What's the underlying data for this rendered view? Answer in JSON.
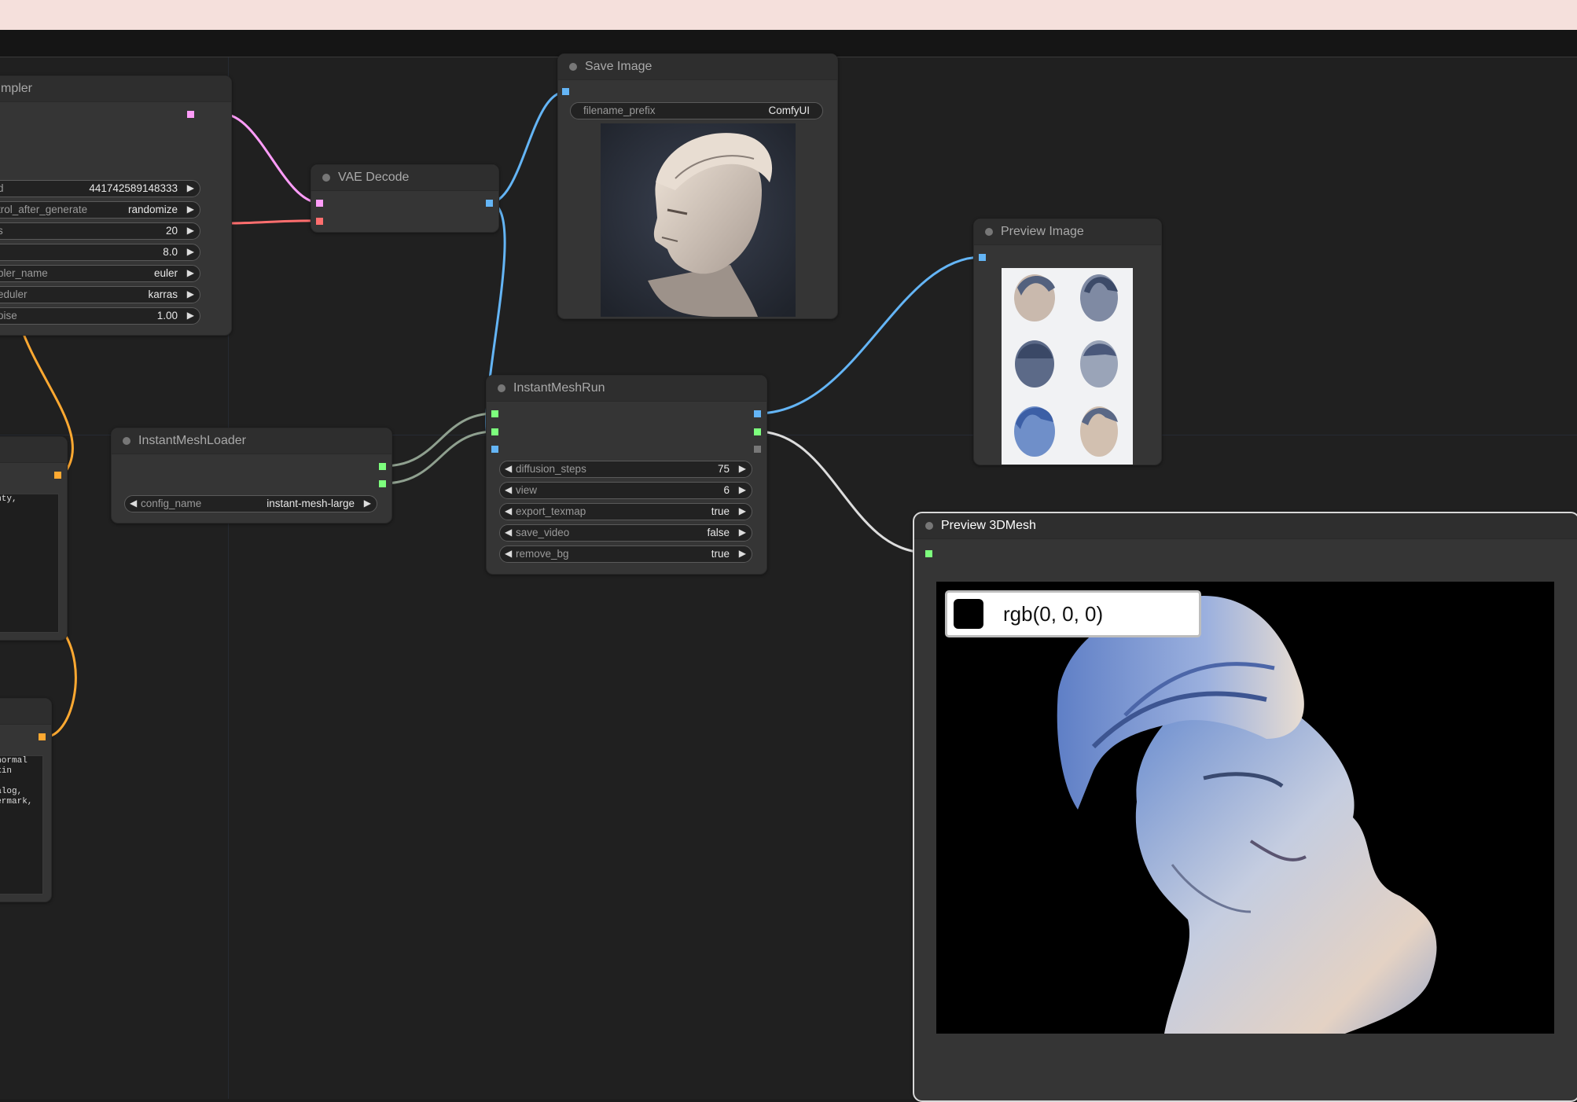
{
  "nodes": {
    "ksampler": {
      "title": "mpler",
      "widgets": [
        {
          "label": "d",
          "value": "441742589148333"
        },
        {
          "label": "trol_after_generate",
          "value": "randomize"
        },
        {
          "label": "s",
          "value": "20"
        },
        {
          "label": "",
          "value": "8.0"
        },
        {
          "label": "pler_name",
          "value": "euler"
        },
        {
          "label": "eduler",
          "value": "karras"
        },
        {
          "label": "oise",
          "value": "1.00"
        }
      ]
    },
    "vae_decode": {
      "title": "VAE Decode"
    },
    "save_image": {
      "title": "Save Image",
      "filename_label": "filename_prefix",
      "filename_value": "ComfyUI"
    },
    "preview_image": {
      "title": "Preview Image"
    },
    "instantmesh_loader": {
      "title": "InstantMeshLoader",
      "config_label": "config_name",
      "config_value": "instant-mesh-large"
    },
    "instantmesh_run": {
      "title": "InstantMeshRun",
      "widgets": [
        {
          "label": "diffusion_steps",
          "value": "75"
        },
        {
          "label": "view",
          "value": "6"
        },
        {
          "label": "export_texmap",
          "value": "true"
        },
        {
          "label": "save_video",
          "value": "false"
        },
        {
          "label": "remove_bg",
          "value": "true"
        }
      ]
    },
    "preview_3dmesh": {
      "title": "Preview 3DMesh",
      "color_text": "rgb(0, 0, 0)"
    },
    "positive_prompt": {
      "text": "ainty,"
    },
    "negative_prompt": {
      "text": " (normal\n skin\n\nanalog,\natermark,"
    }
  },
  "colors": {
    "latent": "#ff9cf9",
    "vae": "#ff6e6e",
    "image": "#64b5f6",
    "conditioning": "#ffa931",
    "model": "#7dff7d",
    "mesh": "#dddddd",
    "link_model": "#8fa08f"
  }
}
